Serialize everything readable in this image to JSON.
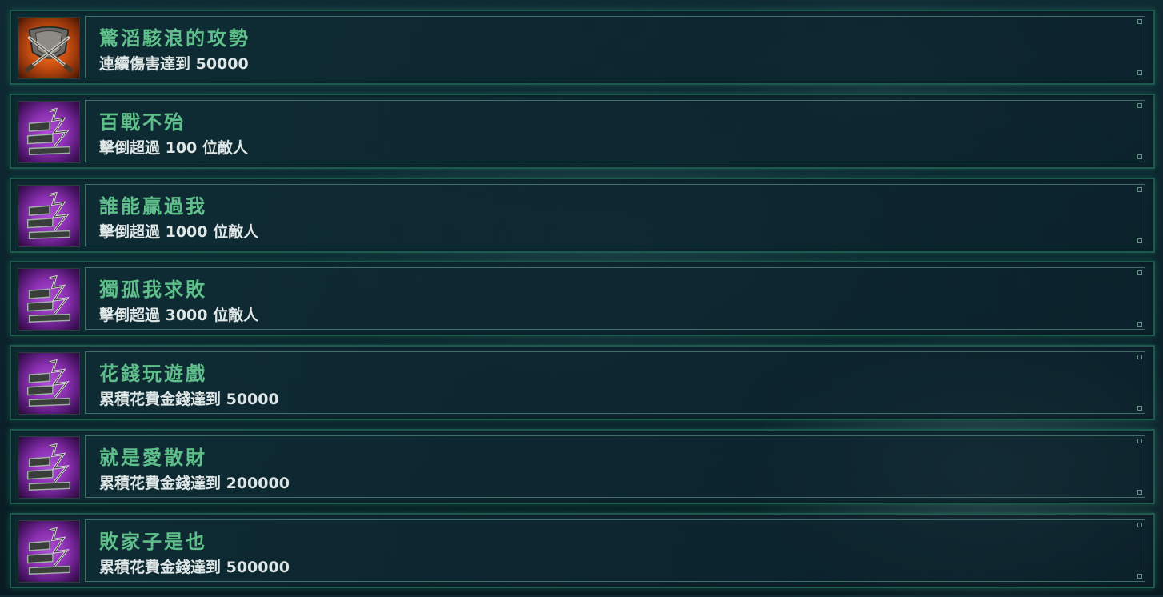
{
  "achievements": [
    {
      "title": "驚滔駭浪的攻勢",
      "desc": "連續傷害達到 50000",
      "icon": "crossed-swords-icon",
      "icon_bg": "#c84e12"
    },
    {
      "title": "百戰不殆",
      "desc": "擊倒超過 100 位敵人",
      "icon": "locked-achievement-icon",
      "icon_bg": "#8a2fb0"
    },
    {
      "title": "誰能贏過我",
      "desc": "擊倒超過 1000 位敵人",
      "icon": "locked-achievement-icon",
      "icon_bg": "#8a2fb0"
    },
    {
      "title": "獨孤我求敗",
      "desc": "擊倒超過 3000 位敵人",
      "icon": "locked-achievement-icon",
      "icon_bg": "#8a2fb0"
    },
    {
      "title": "花錢玩遊戲",
      "desc": "累積花費金錢達到 50000",
      "icon": "locked-achievement-icon",
      "icon_bg": "#8a2fb0"
    },
    {
      "title": "就是愛散財",
      "desc": "累積花費金錢達到 200000",
      "icon": "locked-achievement-icon",
      "icon_bg": "#8a2fb0"
    },
    {
      "title": "敗家子是也",
      "desc": "累積花費金錢達到 500000",
      "icon": "locked-achievement-icon",
      "icon_bg": "#8a2fb0"
    }
  ],
  "colors": {
    "title_green": "#5fbf8a",
    "desc_white": "#dfe6e6",
    "frame_green": "#1b5a4d"
  }
}
